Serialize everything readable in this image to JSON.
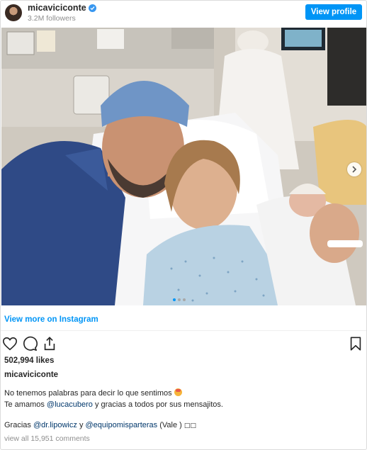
{
  "header": {
    "username": "micaviciconte",
    "followers": "3.2M followers",
    "view_profile_label": "View profile"
  },
  "post": {
    "image_carousel_dots": 3,
    "view_more_label": "View more on Instagram",
    "likes": "502,994 likes",
    "caption_user": "micaviciconte",
    "caption_lines": {
      "line1": "No tenemos palabras para decir lo que sentimos",
      "line2_prefix": "Te amamos ",
      "line2_mention": "@lucacubero",
      "line2_suffix": " y gracias a todos por sus mensajitos.",
      "line3_prefix": "Gracias ",
      "line3_mention1": "@dr.lipowicz",
      "line3_mid": " y ",
      "line3_mention2": "@equipomisparteras",
      "line3_suffix": " (Vale ) ",
      "line3_boxes": "□□"
    },
    "view_all_comments": "view all 15,951 comments"
  },
  "icons": {
    "like": "heart-icon",
    "comment": "comment-icon",
    "share": "share-icon",
    "save": "bookmark-icon",
    "verified": "verified-badge-icon",
    "next": "chevron-right-icon"
  },
  "colors": {
    "accent": "#0095f6",
    "mention": "#00376b",
    "muted": "#8e8e8e",
    "text": "#262626"
  }
}
